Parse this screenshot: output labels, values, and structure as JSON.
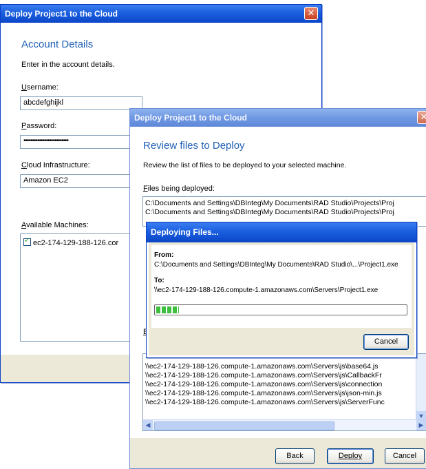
{
  "colors": {
    "titlebar": "#1b5fe0",
    "heading": "#1f5fb5",
    "progress": "#3fbf3f",
    "close": "#d2522c"
  },
  "account_dialog": {
    "title": "Deploy Project1 to the Cloud",
    "close_glyph": "✕",
    "heading": "Account Details",
    "description": "Enter in the account details.",
    "username_label": {
      "accel": "U",
      "rest": "sername:"
    },
    "username_value": "abcdefghijkl",
    "password_label": {
      "accel": "P",
      "rest": "assword:"
    },
    "password_value": "••••••••••••••••••••••••••",
    "cloud_label": {
      "accel": "C",
      "rest": "loud Infrastructure:"
    },
    "cloud_value": "Amazon EC2",
    "machines_label": {
      "accel": "A",
      "rest": "vailable Machines:"
    },
    "machines": [
      {
        "name": "ec2-174-129-188-126.cor",
        "checked": true
      }
    ]
  },
  "review_dialog": {
    "title": "Deploy Project1 to the Cloud",
    "close_glyph": "✕",
    "heading": "Review files to Deploy",
    "description": "Review the list of files to be deployed to your selected machine.",
    "files_label": {
      "accel": "F",
      "rest": "iles being deployed:"
    },
    "files": [
      "C:\\Documents and Settings\\DBInteg\\My Documents\\RAD Studio\\Projects\\Proj",
      "C:\\Documents and Settings\\DBInteg\\My Documents\\RAD Studio\\Projects\\Proj"
    ],
    "files2_label_partial": "E",
    "remote_files": [
      "\\\\ec2-174-129-188-126.compute-1.amazonaws.com\\Servers\\js\\base64.js",
      "\\\\ec2-174-129-188-126.compute-1.amazonaws.com\\Servers\\js\\CallbackFr",
      "\\\\ec2-174-129-188-126.compute-1.amazonaws.com\\Servers\\js\\connection",
      "\\\\ec2-174-129-188-126.compute-1.amazonaws.com\\Servers\\js\\json-min.js",
      "\\\\ec2-174-129-188-126.compute-1.amazonaws.com\\Servers\\js\\ServerFunc"
    ],
    "back_label": "Back",
    "deploy_label": "Deploy",
    "cancel_label": "Cancel"
  },
  "progress_dialog": {
    "title": "Deploying Files...",
    "from_label": "From:",
    "from_value": "C:\\Documents and Settings\\DBInteg\\My Documents\\RAD Studio\\...\\Project1.exe",
    "to_label": "To:",
    "to_value": "\\\\ec2-174-129-188-126.compute-1.amazonaws.com\\Servers\\Project1.exe",
    "progress_fraction": 0.09,
    "cancel_label": "Cancel"
  }
}
